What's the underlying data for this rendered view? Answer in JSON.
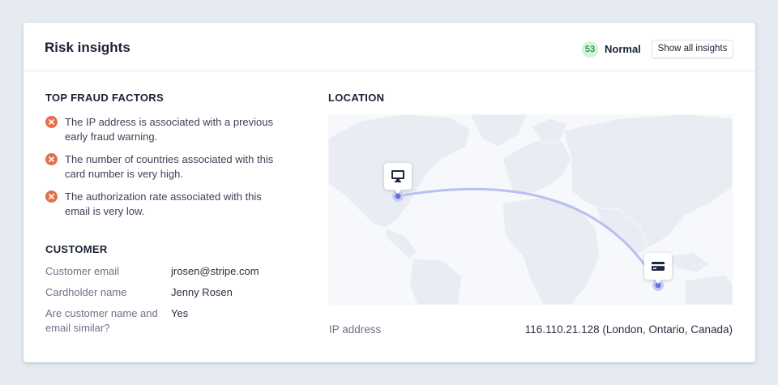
{
  "header": {
    "title": "Risk insights",
    "risk_score": "53",
    "risk_level": "Normal",
    "show_all_label": "Show all insights"
  },
  "fraud": {
    "heading": "TOP FRAUD FACTORS",
    "items": [
      {
        "text": "The IP address is associated with a previous early fraud warning."
      },
      {
        "text": "The number of countries associated with this card number is very high."
      },
      {
        "text": "The authorization rate associated with this email is very low."
      }
    ]
  },
  "customer": {
    "heading": "CUSTOMER",
    "rows": [
      {
        "label": "Customer email",
        "value": "jrosen@stripe.com"
      },
      {
        "label": "Cardholder name",
        "value": "Jenny Rosen"
      },
      {
        "label": "Are customer name and email similar?",
        "value": "Yes"
      }
    ]
  },
  "location": {
    "heading": "LOCATION",
    "ip_label": "IP address",
    "ip_value": "116.110.21.128 (London, Ontario, Canada)"
  },
  "colors": {
    "fraud_icon": "#e56f4a",
    "score_badge_bg": "#cdf5d6",
    "arc": "#aeb6f2",
    "pin_dot": "#6872d9"
  },
  "icons": {
    "ip_pin": "monitor-icon",
    "card_pin": "credit-card-icon",
    "fraud_factor": "x-circle-icon"
  }
}
